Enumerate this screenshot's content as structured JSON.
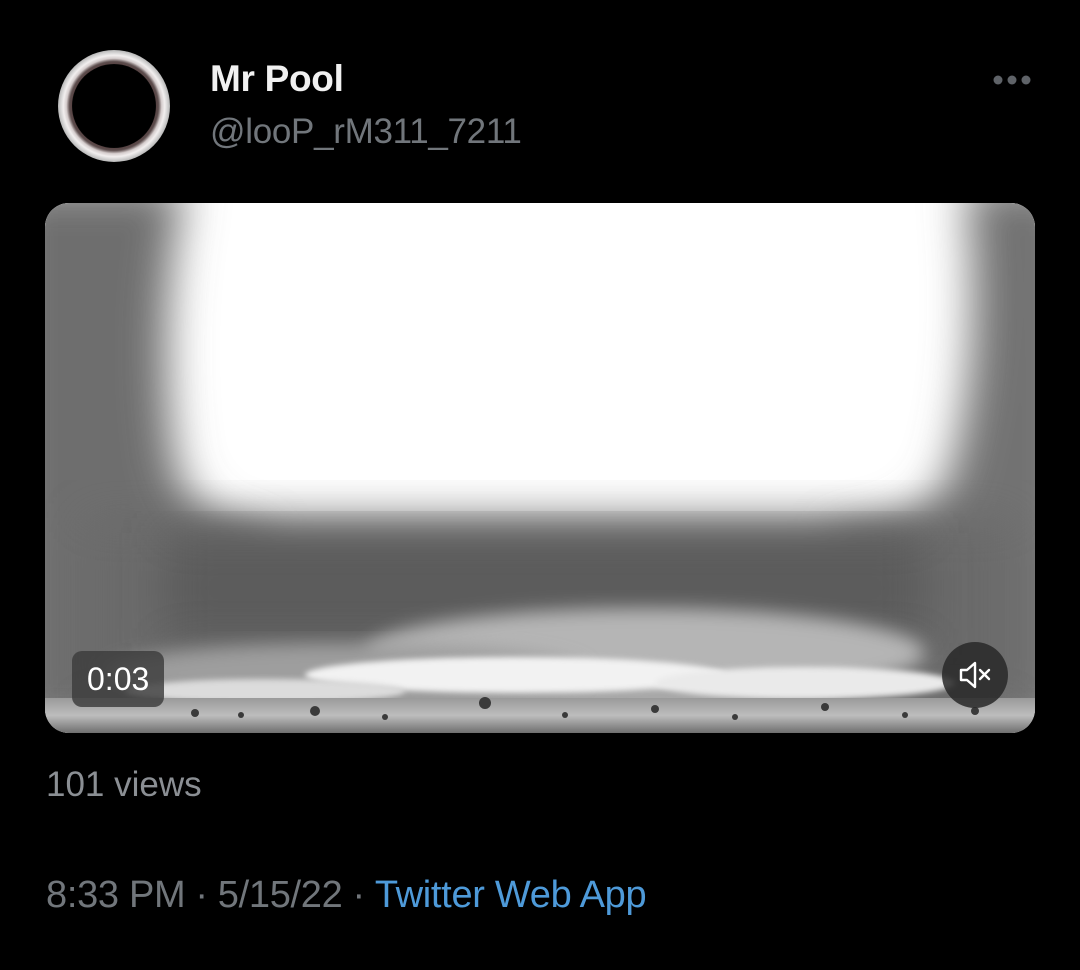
{
  "author": {
    "display_name": "Mr Pool",
    "handle": "@looP_rM311_7211",
    "avatar_icon": "solar-eclipse-avatar"
  },
  "menu": {
    "icon": "more-horizontal-icon"
  },
  "media": {
    "duration_label": "0:03",
    "mute_icon": "speaker-muted-icon"
  },
  "stats": {
    "views_label": "101 views"
  },
  "meta": {
    "time": "8:33 PM",
    "date": "5/15/22",
    "separator": "·",
    "source": "Twitter Web App"
  },
  "colors": {
    "background": "#000000",
    "primary_text": "#f1f1f1",
    "secondary_text": "#71767b",
    "link": "#4e9ad9"
  }
}
